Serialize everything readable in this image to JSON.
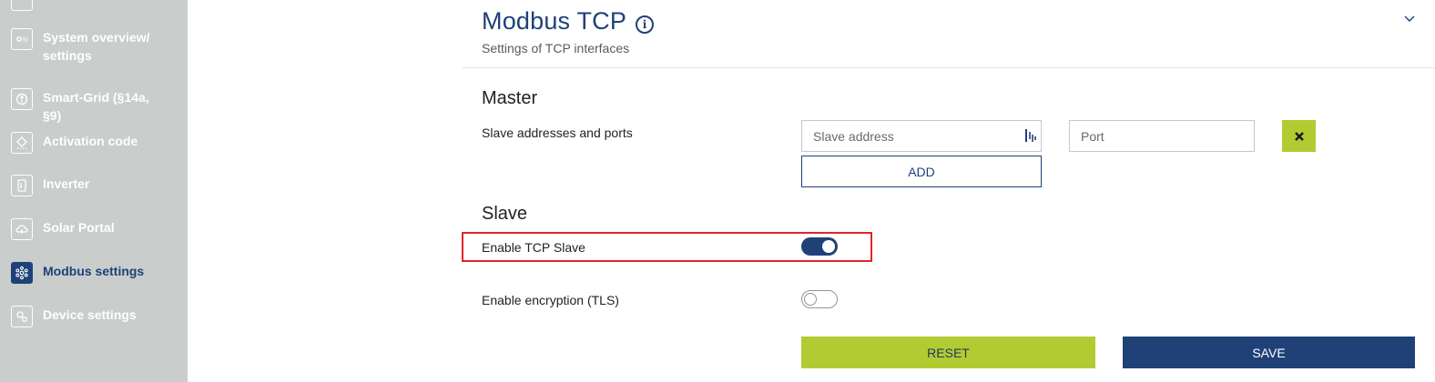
{
  "sidebar": {
    "items": [
      {
        "label": "System overview/ settings",
        "icon": "system-overview-icon"
      },
      {
        "label": "Smart-Grid (§14a, §9)",
        "icon": "smart-grid-icon"
      },
      {
        "label": "Activation code",
        "icon": "activation-code-icon"
      },
      {
        "label": "Inverter",
        "icon": "inverter-icon"
      },
      {
        "label": "Solar Portal",
        "icon": "solar-portal-icon"
      },
      {
        "label": "Modbus settings",
        "icon": "modbus-icon",
        "active": true
      },
      {
        "label": "Device settings",
        "icon": "device-settings-icon"
      }
    ]
  },
  "header": {
    "title": "Modbus TCP",
    "info_glyph": "i",
    "subtitle": "Settings of TCP interfaces"
  },
  "master": {
    "title": "Master",
    "row_label": "Slave addresses and ports",
    "slave_address_placeholder": "Slave address",
    "port_placeholder": "Port",
    "add_label": "ADD"
  },
  "slave": {
    "title": "Slave",
    "enable_tcp_label": "Enable TCP Slave",
    "enable_tcp_on": true,
    "enable_tls_label": "Enable encryption (TLS)",
    "enable_tls_on": false
  },
  "actions": {
    "reset_label": "RESET",
    "save_label": "SAVE"
  },
  "colors": {
    "brand_blue": "#1f4178",
    "accent_green": "#b3cb32",
    "sidebar_bg": "#c9cdcc",
    "highlight_red": "#e3242b"
  }
}
